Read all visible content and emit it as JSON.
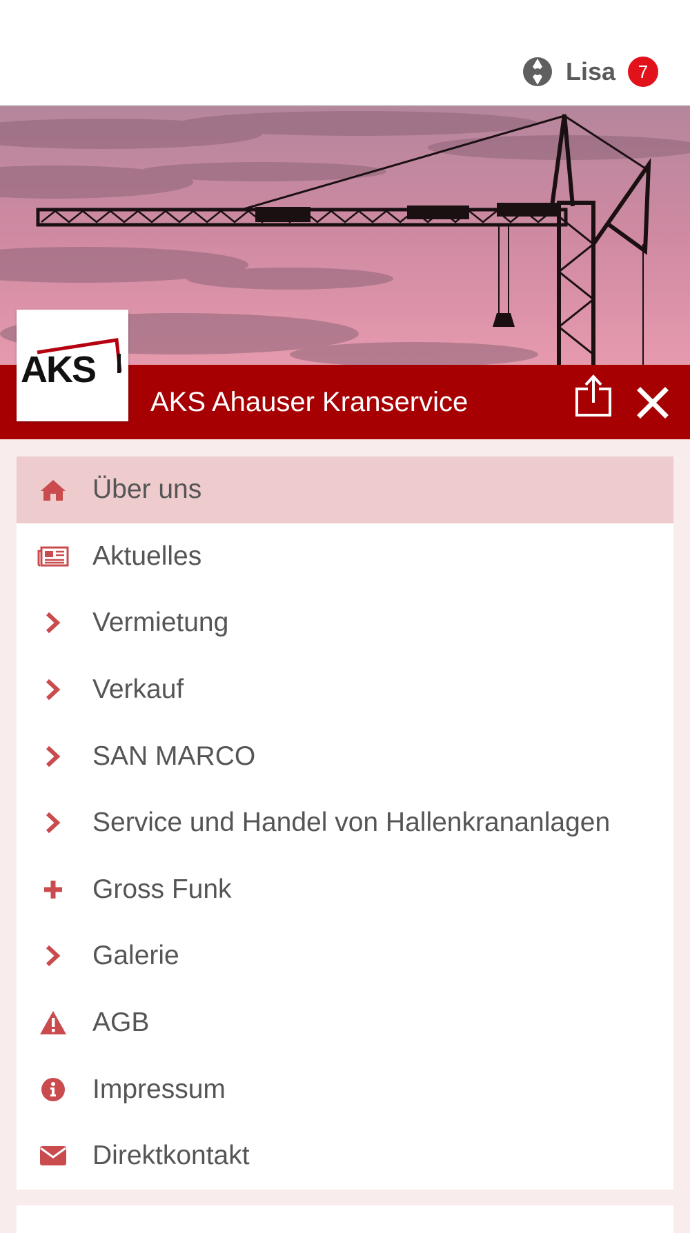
{
  "header": {
    "user_name": "Lisa",
    "notification_count": "7"
  },
  "app": {
    "title": "AKS Ahauser Kranservice",
    "logo_text": "AKS"
  },
  "colors": {
    "brand": "#a60003",
    "accent_icon": "#c94b4e",
    "active_bg": "#eecbcc",
    "badge": "#e2121b"
  },
  "menu": {
    "items": [
      {
        "label": "Über uns",
        "icon": "home-icon",
        "active": true
      },
      {
        "label": "Aktuelles",
        "icon": "newspaper-icon"
      },
      {
        "label": "Vermietung",
        "icon": "chevron-right-icon"
      },
      {
        "label": "Verkauf",
        "icon": "chevron-right-icon"
      },
      {
        "label": "SAN MARCO",
        "icon": "chevron-right-icon"
      },
      {
        "label": "Service und Handel von Hallenkrananlagen",
        "icon": "chevron-right-icon"
      },
      {
        "label": "Gross Funk",
        "icon": "plus-icon"
      },
      {
        "label": "Galerie",
        "icon": "chevron-right-icon"
      },
      {
        "label": "AGB",
        "icon": "warning-icon"
      },
      {
        "label": "Impressum",
        "icon": "info-icon"
      },
      {
        "label": "Direktkontakt",
        "icon": "envelope-icon"
      }
    ]
  }
}
